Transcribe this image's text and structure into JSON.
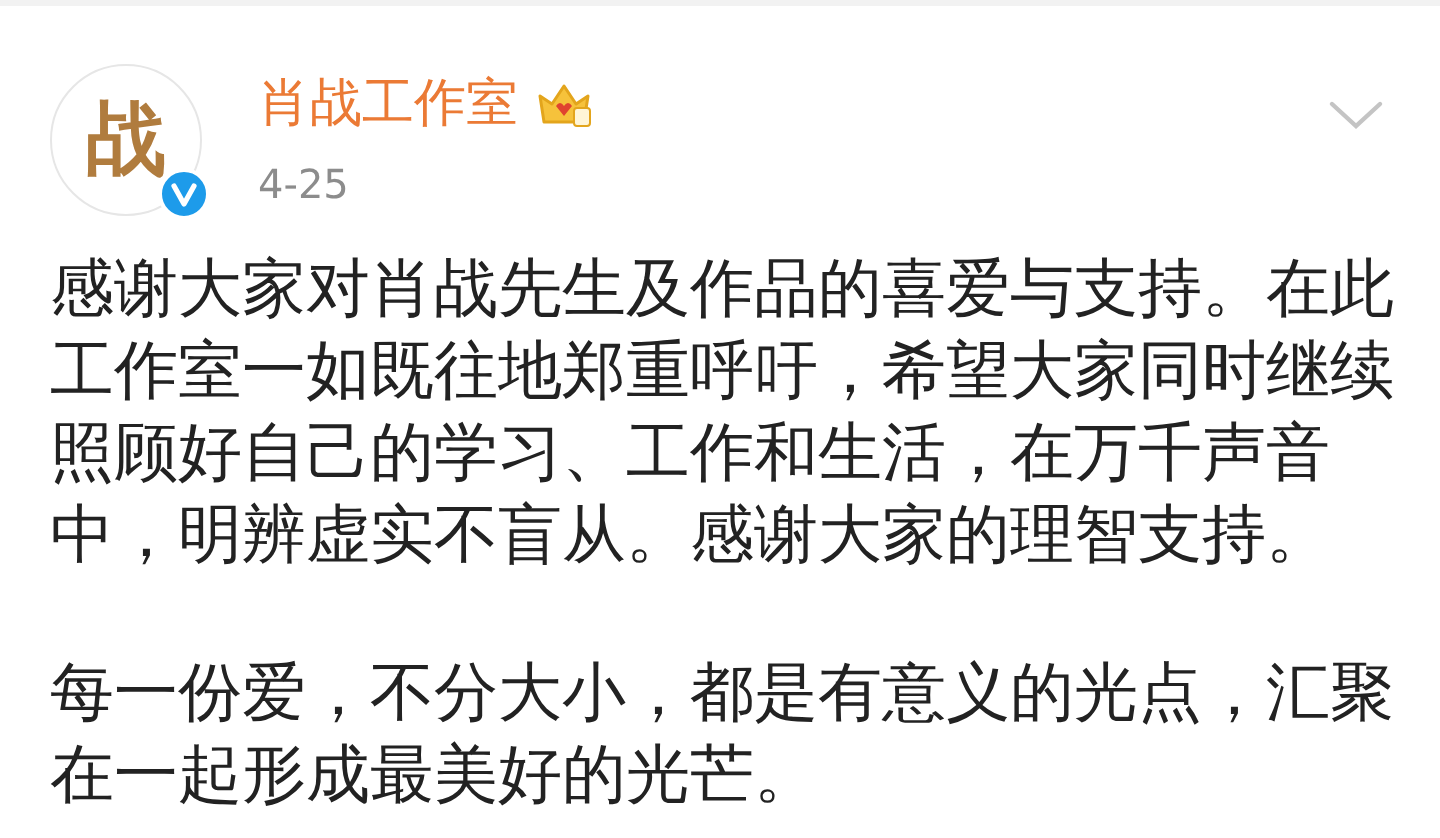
{
  "post": {
    "author": {
      "avatar_mark": "战",
      "name": "肖战工作室",
      "verified": true
    },
    "date": "4-25",
    "paragraphs": [
      "感谢大家对肖战先生及作品的喜爱与支持。在此工作室一如既往地郑重呼吁，希望大家同时继续照顾好自己的学习、工作和生活，在万千声音中，明辨虚实不盲从。感谢大家的理智支持。",
      "每一份爱，不分大小，都是有意义的光点，汇聚在一起形成最美好的光芒。"
    ]
  }
}
